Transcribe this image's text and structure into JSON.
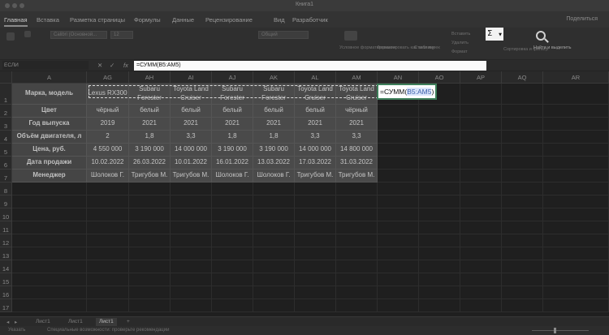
{
  "window": {
    "title": "Книга1"
  },
  "menu": {
    "tabs": [
      "Главная",
      "Вставка",
      "Разметка страницы",
      "Формулы",
      "Данные",
      "Рецензирование",
      "Вид",
      "Разработчик"
    ],
    "share": "Поделиться"
  },
  "ribbon": {
    "font_name": "Calibri (Основной...",
    "font_size": "12",
    "number_format": "Общий",
    "cond_format": "Условное форматирование",
    "format_table": "Форматировать как таблицу",
    "cell_styles": "Стили ячеек",
    "insert": "Вставить",
    "delete": "Удалить",
    "format": "Формат",
    "sort_filter": "Сортировка и фильтр",
    "find_select": "Найти и выделить",
    "autosum_icon": "Σ"
  },
  "formula_bar": {
    "name_box": "ЕСЛИ",
    "fx": "fx",
    "content": "=СУММ(B5:AM5)"
  },
  "columns": [
    "A",
    "AG",
    "AH",
    "AI",
    "AJ",
    "AK",
    "AL",
    "AM",
    "AN",
    "AO",
    "AP",
    "AQ",
    "AR"
  ],
  "rows": [
    "1",
    "2",
    "3",
    "4",
    "5",
    "6",
    "7",
    "8",
    "9",
    "10",
    "11",
    "12",
    "13",
    "14",
    "15",
    "16",
    "17"
  ],
  "table": {
    "labels": [
      "Марка, модель",
      "Цвет",
      "Год выпуска",
      "Объём двигателя, л",
      "Цена, руб.",
      "Дата продажи",
      "Менеджер"
    ],
    "data": [
      [
        "Lexus RX300",
        "Subaru Forester",
        "Toyota Land Cruiser",
        "Subaru Forester",
        "Subaru Forester",
        "Toyota Land Cruiser",
        "Toyota Land Cruiser"
      ],
      [
        "чёрный",
        "белый",
        "белый",
        "белый",
        "белый",
        "белый",
        "чёрный"
      ],
      [
        "2019",
        "2021",
        "2021",
        "2021",
        "2021",
        "2021",
        "2021"
      ],
      [
        "2",
        "1,8",
        "3,3",
        "1,8",
        "1,8",
        "3,3",
        "3,3"
      ],
      [
        "4 550 000",
        "3 190 000",
        "14 000 000",
        "3 190 000",
        "3 190 000",
        "14 000 000",
        "14 800 000"
      ],
      [
        "10.02.2022",
        "26.03.2022",
        "10.01.2022",
        "16.01.2022",
        "13.03.2022",
        "17.03.2022",
        "31.03.2022"
      ],
      [
        "Шолоков Г.",
        "Тригубов М.",
        "Тригубов М.",
        "Шолоков Г.",
        "Шолоков Г.",
        "Тригубов М.",
        "Тригубов М."
      ]
    ]
  },
  "edit_cell": {
    "prefix": "=СУММ(",
    "ref": "B5:AM5",
    "suffix": ")"
  },
  "sheets": [
    "Лист1",
    "Лист1",
    "Лист1"
  ],
  "status": {
    "mode": "Указать",
    "accessibility": "Специальные возможности: проверьте рекомендации"
  }
}
